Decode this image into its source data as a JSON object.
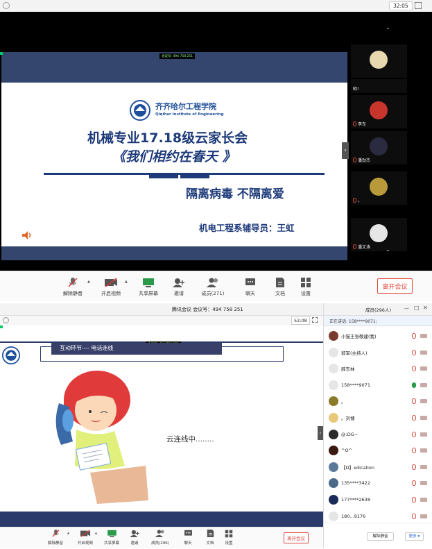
{
  "top": {
    "timer": "32:05",
    "meeting_badge": "会议号: 494 758 251",
    "slide": {
      "school_cn": "齐齐哈尔工程学院",
      "school_en": "Qiqihar Institute of Engineering",
      "title1": "机械专业17.18级云家长会",
      "title2": "《我们相约在春天 》",
      "slogan": "隔离病毒 不隔离爱",
      "author": "机电工程系辅导员：王虹"
    },
    "participants": [
      "",
      "昭!",
      "李东",
      "潘劲杰",
      "。",
      "潘文涛"
    ],
    "toolbar": {
      "mute": "解除静音",
      "video": "开启视频",
      "share": "共享屏幕",
      "invite": "邀请",
      "members": "成员(271)",
      "chat": "聊天",
      "docs": "文档",
      "settings": "设置",
      "leave": "离开会议"
    }
  },
  "bottom": {
    "title": "腾讯会议 会议号：494 758 251",
    "timer": "52:08",
    "meeting_badge": "会议号: 494 758 251",
    "slide": {
      "header": "互动环节---- 电话连线",
      "calling": "云连线中........"
    },
    "toolbar": {
      "mute": "解除静音",
      "video": "开启视频",
      "share": "共享屏幕",
      "invite": "邀请",
      "members": "成员(296)",
      "chat": "聊天",
      "docs": "文档",
      "settings": "设置",
      "leave": "离开会议"
    },
    "members_panel": {
      "title": "成员(296人)",
      "speaking": "正在讲话: 158****9071;",
      "members": [
        {
          "name": "小猫王张敬建(我)",
          "color": "#7a3b2e"
        },
        {
          "name": "郭军(主持人)",
          "color": "#e6e6e6"
        },
        {
          "name": "薛东林",
          "color": "#e6e6e6"
        },
        {
          "name": "158****9071",
          "color": "#e6e6e6"
        },
        {
          "name": "。",
          "color": "#8a7a2a"
        },
        {
          "name": "。刘博",
          "color": "#e8c87a"
        },
        {
          "name": "@:DG~",
          "color": "#2a2a2a"
        },
        {
          "name": "^O^",
          "color": "#3a1a10"
        },
        {
          "name": "【D】edication",
          "color": "#5a7a9a"
        },
        {
          "name": "135****3422",
          "color": "#4a6a8a"
        },
        {
          "name": "177****2638",
          "color": "#1a2a5a"
        },
        {
          "name": "180...9176",
          "color": "#e6e6e6"
        }
      ],
      "unmute_all": "解除静音",
      "more": "更多 ▾"
    }
  },
  "colors": {
    "accent_red": "#e0473b",
    "navy": "#34466e",
    "blue": "#1e5bd6"
  }
}
